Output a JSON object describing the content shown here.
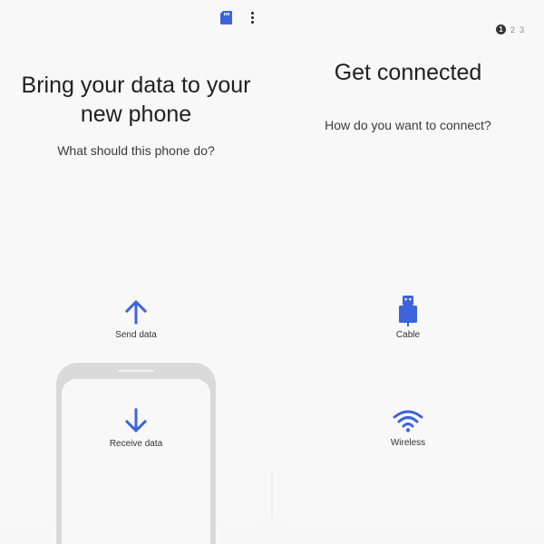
{
  "left_panel": {
    "title_line1": "Bring your data to your",
    "title_line2": "new phone",
    "subtitle": "What should this phone do?",
    "options": [
      {
        "label": "Send data",
        "icon": "arrow-up-icon"
      },
      {
        "label": "Receive data",
        "icon": "arrow-down-icon"
      }
    ],
    "toolbar": {
      "sd_card_icon": "sd-card-icon",
      "more_icon": "more-vert-icon"
    }
  },
  "right_panel": {
    "title": "Get connected",
    "subtitle": "How do you want to connect?",
    "pager": {
      "current": "1",
      "pages": [
        "1",
        "2",
        "3"
      ]
    },
    "options": [
      {
        "label": "Cable",
        "icon": "usb-cable-icon"
      },
      {
        "label": "Wireless",
        "icon": "wifi-icon"
      }
    ]
  },
  "colors": {
    "accent": "#3d63dd",
    "text": "#202020",
    "phone_outline": "#dadada"
  }
}
